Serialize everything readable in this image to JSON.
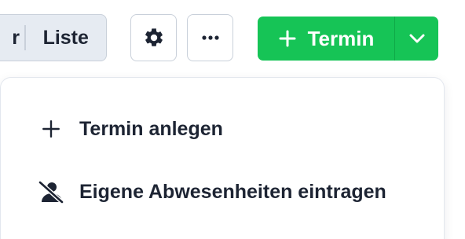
{
  "toolbar": {
    "view_toggle": {
      "prev_segment_label": "r",
      "list_label": "Liste"
    },
    "settings_icon": "gear-icon",
    "more_icon": "more-horizontal-icon",
    "new_appointment": {
      "label": "Termin",
      "icon": "plus-icon",
      "dropdown_icon": "chevron-down-icon"
    },
    "accent_color": "#16c456"
  },
  "menu": {
    "items": [
      {
        "label": "Termin anlegen",
        "icon": "plus-icon"
      },
      {
        "label": "Eigene Abwesenheiten eintragen",
        "icon": "person-off-icon"
      }
    ]
  }
}
